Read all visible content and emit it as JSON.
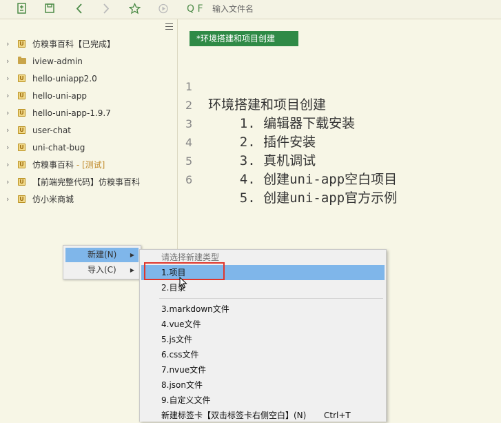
{
  "toolbar": {
    "icons": [
      "new-file-icon",
      "save-icon",
      "back-icon",
      "forward-icon",
      "star-icon",
      "run-icon"
    ],
    "search_prefix": "Q F",
    "search_placeholder": "输入文件名"
  },
  "sidebar": {
    "items": [
      {
        "label": "仿糗事百科【已完成】",
        "tag": "",
        "icon": "project-icon"
      },
      {
        "label": "iview-admin",
        "tag": "",
        "icon": "folder-icon"
      },
      {
        "label": "hello-uniapp2.0",
        "tag": "",
        "icon": "project-icon"
      },
      {
        "label": "hello-uni-app",
        "tag": "",
        "icon": "project-icon"
      },
      {
        "label": "hello-uni-app-1.9.7",
        "tag": "",
        "icon": "project-icon"
      },
      {
        "label": "user-chat",
        "tag": "",
        "icon": "project-icon"
      },
      {
        "label": "uni-chat-bug",
        "tag": "",
        "icon": "project-icon"
      },
      {
        "label": "仿糗事百科",
        "tag": "- [测试]",
        "icon": "project-icon"
      },
      {
        "label": "【前端完整代码】仿糗事百科",
        "tag": "",
        "icon": "project-icon"
      },
      {
        "label": "仿小米商城",
        "tag": "",
        "icon": "project-icon"
      }
    ]
  },
  "editor": {
    "tab_label": "*环境搭建和项目创建",
    "lines": [
      {
        "num": "1",
        "text": "环境搭建和项目创建"
      },
      {
        "num": "2",
        "text": "    1. 编辑器下载安装"
      },
      {
        "num": "3",
        "text": "    2. 插件安装"
      },
      {
        "num": "4",
        "text": "    3. 真机调试"
      },
      {
        "num": "5",
        "text": "    4. 创建uni-app空白项目"
      },
      {
        "num": "6",
        "text": "    5. 创建uni-app官方示例"
      }
    ]
  },
  "context_menu": {
    "items": [
      {
        "label": "新建(N)"
      },
      {
        "label": "导入(C)"
      }
    ]
  },
  "submenu": {
    "header": "请选择新建类型",
    "items": [
      {
        "label": "1.项目",
        "shortcut": ""
      },
      {
        "label": "2.目录",
        "shortcut": ""
      },
      {
        "label": "3.markdown文件",
        "shortcut": ""
      },
      {
        "label": "4.vue文件",
        "shortcut": ""
      },
      {
        "label": "5.js文件",
        "shortcut": ""
      },
      {
        "label": "6.css文件",
        "shortcut": ""
      },
      {
        "label": "7.nvue文件",
        "shortcut": ""
      },
      {
        "label": "8.json文件",
        "shortcut": ""
      },
      {
        "label": "9.自定义文件",
        "shortcut": ""
      },
      {
        "label": "新建标签卡【双击标签卡右侧空白】(N)",
        "shortcut": "Ctrl+T"
      }
    ]
  },
  "colors": {
    "accent": "#2f8a46",
    "menu_highlight": "#7fb6ea",
    "annotation_box": "#e0362c"
  }
}
